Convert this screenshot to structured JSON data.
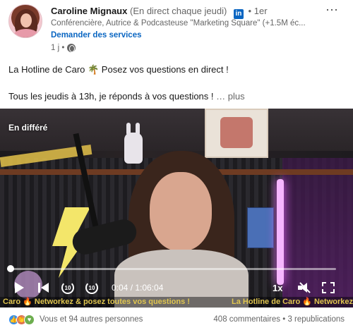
{
  "author": {
    "name": "Caroline Mignaux",
    "status": "(En direct chaque jeudi)",
    "network_badge": "in",
    "degree": "1er",
    "headline": "Conférencière, Autrice & Podcasteuse \"Marketing Square\" (+1.5M éc...",
    "services_link": "Demander des services",
    "time_ago": "1 j",
    "visibility_icon": "globe-icon"
  },
  "menu_icon": "⋯",
  "post": {
    "line1": "La Hotline de Caro 🌴 Posez vos questions en direct !",
    "line2": "Tous les jeudis à 13h, je réponds à vos questions !",
    "more": "… plus"
  },
  "video": {
    "badge": "En différé",
    "progress": 0.0006,
    "time": "0:04 / 1:06:04",
    "speed": "1x",
    "ticker_left": "Caro 🔥 Networkez & posez toutes vos questions !",
    "ticker_right": "La Hotline de Caro 🔥 Networkez",
    "ticker_left_partial_prefix": "",
    "rewind_label": "10",
    "forward_label": "10"
  },
  "social": {
    "reactions_text": "Vous et 94 autres personnes",
    "comments": "408 commentaires",
    "separator": " • ",
    "reposts": "3 republications"
  },
  "colors": {
    "accent": "#0a66c2",
    "ticker": "#e0c64f"
  }
}
